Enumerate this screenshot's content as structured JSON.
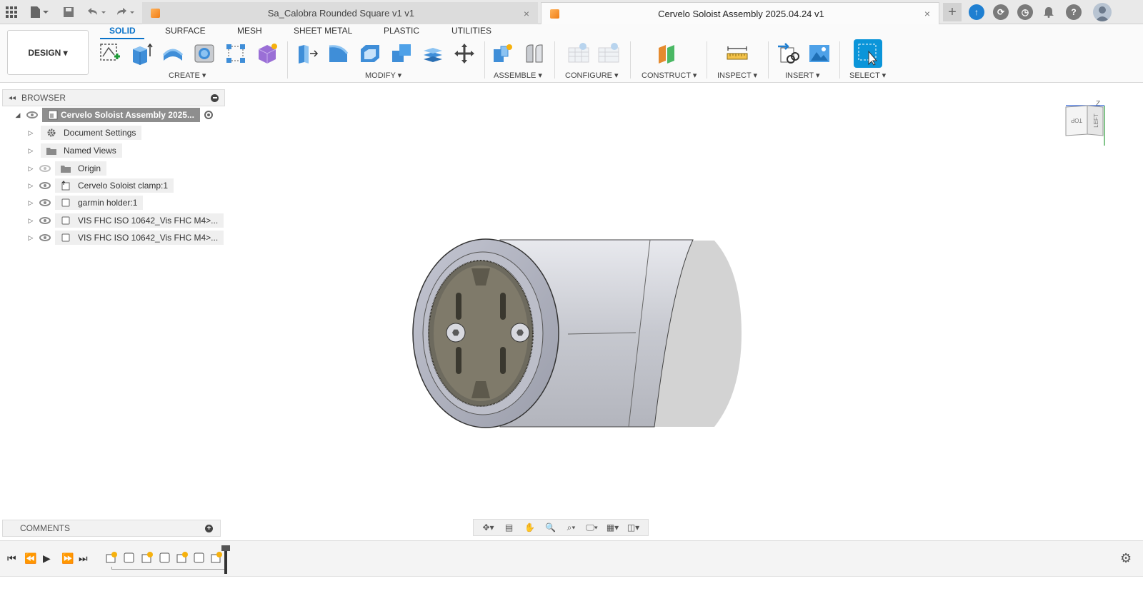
{
  "titlebar": {
    "tabs": [
      {
        "label": "Sa_Calobra Rounded Square v1 v1",
        "active": false
      },
      {
        "label": "Cervelo Soloist Assembly 2025.04.24 v1",
        "active": true
      }
    ],
    "close_glyph": "×",
    "new_tab_glyph": "+"
  },
  "toolbar": {
    "workspace": "DESIGN ▾",
    "tabs": [
      "SOLID",
      "SURFACE",
      "MESH",
      "SHEET METAL",
      "PLASTIC",
      "UTILITIES"
    ],
    "groups": [
      "CREATE ▾",
      "MODIFY ▾",
      "ASSEMBLE ▾",
      "CONFIGURE ▾",
      "CONSTRUCT ▾",
      "INSPECT ▾",
      "INSERT ▾",
      "SELECT ▾"
    ]
  },
  "browser": {
    "title": "BROWSER",
    "root": "Cervelo Soloist Assembly 2025...",
    "items": [
      {
        "label": "Document Settings",
        "icon": "gear-icon"
      },
      {
        "label": "Named Views",
        "icon": "folder-icon"
      },
      {
        "label": "Origin",
        "icon": "folder-icon",
        "hidden": true
      },
      {
        "label": "Cervelo Soloist clamp:1",
        "icon": "component-link-icon"
      },
      {
        "label": "garmin holder:1",
        "icon": "component-icon"
      },
      {
        "label": "VIS FHC ISO 10642_Vis FHC M4>...",
        "icon": "component-icon"
      },
      {
        "label": "VIS FHC ISO 10642_Vis FHC M4>...",
        "icon": "component-icon"
      }
    ]
  },
  "comments": {
    "title": "COMMENTS"
  },
  "viewcube": {
    "top": "TOP",
    "left": "LEFT",
    "axis": "Z"
  },
  "colors": {
    "accent": "#0a73c9",
    "select_blue": "#0b95d9",
    "model_gray": "#b9bac1"
  }
}
